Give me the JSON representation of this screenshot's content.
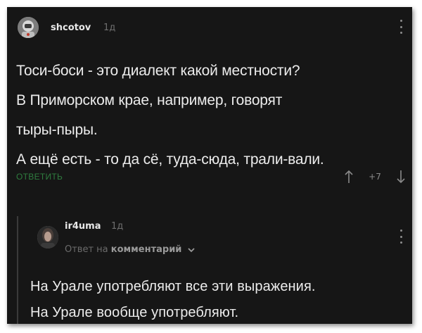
{
  "comment1": {
    "username": "shcotov",
    "time": "1д",
    "lines": [
      "Тоси-боси - это диалект какой местности?",
      "В Приморском крае, например, говорят",
      "тыры-пыры.",
      "А ещё есть - то да сё, туда-сюда, трали-вали."
    ],
    "reply_label": "ОТВЕТИТЬ",
    "vote_count": "+7",
    "avatar_icon": "avatar-astronaut-icon"
  },
  "comment2": {
    "username": "ir4uma",
    "time": "1д",
    "reply_to_prefix": "Ответ на",
    "reply_to_target": "комментарий",
    "lines": [
      "На Урале употребляют все эти выражения.",
      "На Урале вообще употребляют."
    ],
    "avatar_icon": "avatar-photo-icon"
  },
  "colors": {
    "background": "#161616",
    "text": "#ececec",
    "muted": "#6f6f6f",
    "reply_link": "#2f7d3f"
  }
}
